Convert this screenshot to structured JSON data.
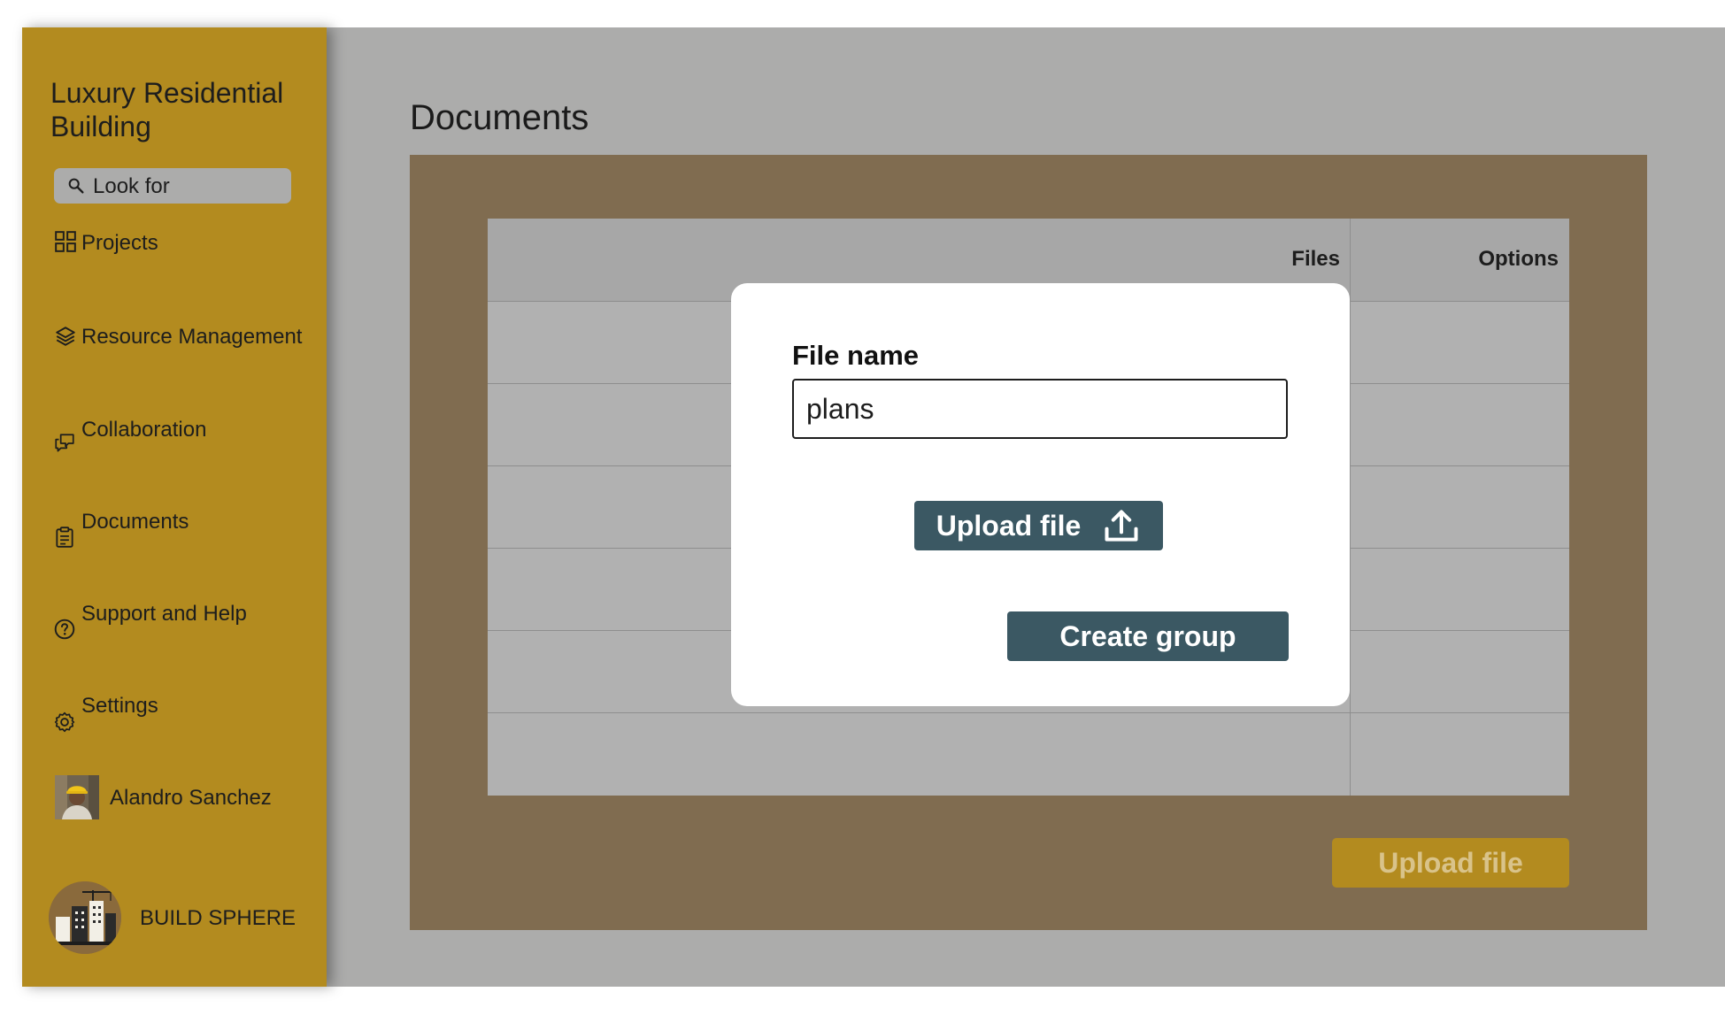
{
  "sidebar": {
    "project_title": "Luxury Residential Building",
    "search": {
      "icon": "search-icon",
      "label": "Look for"
    },
    "items": [
      {
        "label": "Projects",
        "icon": "grid-icon"
      },
      {
        "label": "Resource Management",
        "icon": "layers-icon"
      },
      {
        "label": "Collaboration",
        "icon": "chat-icon"
      },
      {
        "label": "Documents",
        "icon": "clipboard-icon"
      },
      {
        "label": "Support and Help",
        "icon": "help-icon"
      },
      {
        "label": "Settings",
        "icon": "gear-icon"
      }
    ],
    "user": {
      "name": "Alandro Sanchez"
    },
    "brand": "BUILD SPHERE"
  },
  "main": {
    "title": "Documents",
    "table": {
      "columns": [
        "Files",
        "Options"
      ],
      "row_count": 6
    },
    "upload_button": "Upload file"
  },
  "modal": {
    "label": "File name",
    "input_value": "plans",
    "upload_button": "Upload file",
    "upload_icon": "upload-icon",
    "create_button": "Create group"
  },
  "colors": {
    "sidebar": "#b38b1f",
    "background": "#acacab",
    "panel": "#806c50",
    "table": "#b1b1b1",
    "button_dark": "#3b5863",
    "modal": "#ffffff"
  }
}
